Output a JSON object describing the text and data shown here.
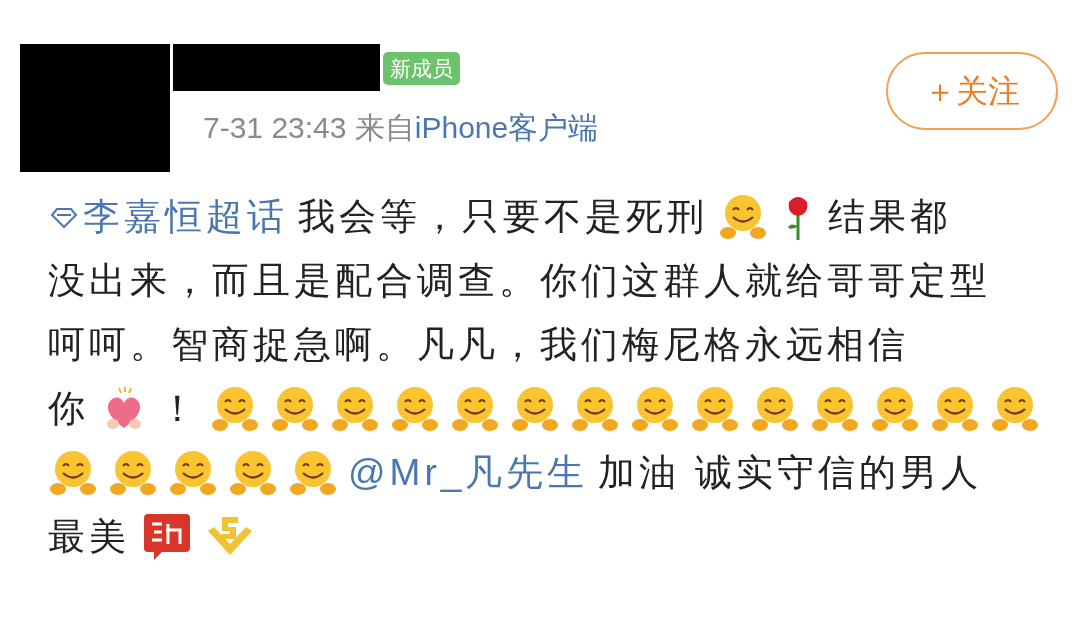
{
  "author": {
    "badge": "新成员",
    "time": "7-31 23:43",
    "source_prefix": "来自",
    "source": "iPhone客户端"
  },
  "follow_button": {
    "label": "＋关注"
  },
  "body_lines": [
    [
      {
        "kind": "topic",
        "text": "李嘉恒超话"
      },
      {
        "kind": "text",
        "text": "我会等，只要不是死刑"
      },
      {
        "kind": "hug"
      },
      {
        "kind": "rose"
      },
      {
        "kind": "text",
        "text": "结果都"
      }
    ],
    [
      {
        "kind": "text",
        "text": "没出来，而且是配合调查。你们这群人就给哥哥定型"
      }
    ],
    [
      {
        "kind": "text",
        "text": "呵呵。智商捉急啊。凡凡，我们梅尼格永远相信"
      }
    ],
    [
      {
        "kind": "text",
        "text": "你"
      },
      {
        "kind": "heart"
      },
      {
        "kind": "text",
        "text": "！"
      },
      {
        "kind": "hug"
      },
      {
        "kind": "hug"
      },
      {
        "kind": "hug"
      },
      {
        "kind": "hug"
      },
      {
        "kind": "hug"
      },
      {
        "kind": "hug"
      },
      {
        "kind": "hug"
      },
      {
        "kind": "hug"
      },
      {
        "kind": "hug"
      },
      {
        "kind": "hug"
      },
      {
        "kind": "hug"
      },
      {
        "kind": "hug"
      },
      {
        "kind": "hug"
      },
      {
        "kind": "hug"
      }
    ],
    [
      {
        "kind": "hug"
      },
      {
        "kind": "hug"
      },
      {
        "kind": "hug"
      },
      {
        "kind": "hug"
      },
      {
        "kind": "hug"
      },
      {
        "kind": "mention",
        "text": "@Mr_凡先生"
      },
      {
        "kind": "text",
        "text": "加油 诚实守信的男人"
      }
    ],
    [
      {
        "kind": "text",
        "text": "最美"
      },
      {
        "kind": "sticker"
      },
      {
        "kind": "chevron"
      }
    ]
  ]
}
